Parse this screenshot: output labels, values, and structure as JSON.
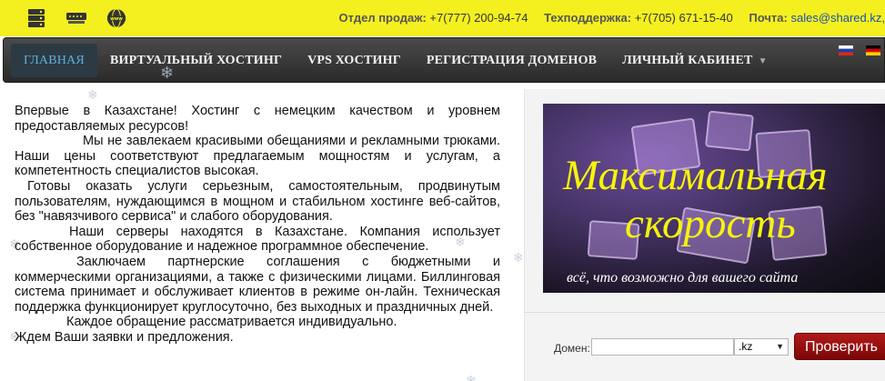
{
  "header": {
    "icons": [
      "server-icon",
      "network-switch-icon",
      "www-globe-icon"
    ],
    "sales_label": "Отдел продаж:",
    "sales_phone": "+7(777) 200-94-74",
    "support_label": "Техподдержка:",
    "support_phone": "+7(705) 671-15-40",
    "mail_label": "Почта:",
    "mail_value": "sales@shared.kz,"
  },
  "nav": {
    "items": [
      {
        "label": "ГЛАВНАЯ",
        "active": true
      },
      {
        "label": "ВИРТУАЛЬНЫЙ ХОСТИНГ"
      },
      {
        "label": "VPS ХОСТИНГ"
      },
      {
        "label": "РЕГИСТРАЦИЯ ДОМЕНОВ"
      },
      {
        "label": "ЛИЧНЫЙ КАБИНЕТ",
        "has_dropdown": true
      }
    ],
    "flags": [
      "russia-flag-icon",
      "germany-flag-icon"
    ]
  },
  "content": {
    "paragraphs": [
      "Впервые в Казахстане! Хостинг с немецким качеством и уровнем предоставляемых ресурсов!",
      "Мы не завлекаем красивыми обещаниями и рекламными трюками. Наши цены соответствуют предлагаемым мощностям и услугам, а компетентность специалистов высокая.",
      "Готовы оказать услуги серьезным, самостоятельным, продвинутым пользователям, нуждающимся в мощном и стабильном хостинге веб-сайтов, без \"навязчивого сервиса\" и слабого оборудования.",
      "Наши серверы находятся в Казахстане. Компания использует собственное оборудование и надежное программное обеспечение.",
      "Заключаем партнерские соглашения с бюджетными и коммерческими организациями, а также с физическими лицами. Биллинговая система принимает и обслуживает клиентов в режиме он-лайн. Техническая поддержка функционирует круглосуточно, без выходных и праздничных дней.",
      "Каждое обращение рассматривается индивидуально.",
      "Ждем Ваши заявки и предложения."
    ]
  },
  "banner": {
    "title_line1": "Максимальная",
    "title_line2": "скорость",
    "subtitle": "всё, что возможно для вашего сайта",
    "title_color": "#f7f30a"
  },
  "domain_check": {
    "label": "Домен:",
    "input_value": "",
    "zone_selected": ".kz",
    "button_label": "Проверить"
  },
  "colors": {
    "topbar": "#f4f020",
    "nav_bg": "#333333",
    "nav_active_text": "#5fb0df",
    "button": "#9e1010"
  }
}
